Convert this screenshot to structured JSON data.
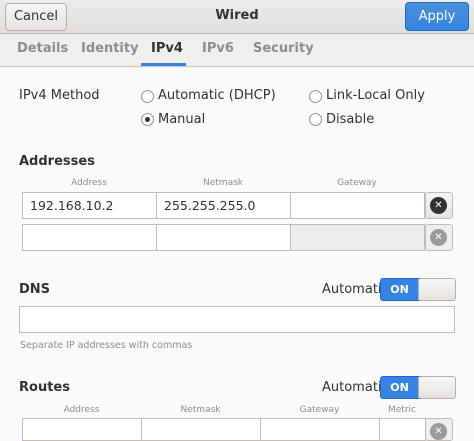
{
  "header": {
    "cancel_label": "Cancel",
    "title": "Wired",
    "apply_label": "Apply"
  },
  "tabs": [
    "Details",
    "Identity",
    "IPv4",
    "IPv6",
    "Security"
  ],
  "ipv4_method": {
    "label": "IPv4 Method",
    "options": [
      "Automatic (DHCP)",
      "Link-Local Only",
      "Manual",
      "Disable"
    ],
    "selected": "Manual"
  },
  "addresses": {
    "heading": "Addresses",
    "columns": [
      "Address",
      "Netmask",
      "Gateway"
    ],
    "rows": [
      {
        "address": "192.168.10.2",
        "netmask": "255.255.255.0",
        "gateway": ""
      },
      {
        "address": "",
        "netmask": "",
        "gateway": ""
      }
    ]
  },
  "dns": {
    "heading": "DNS",
    "automatic_label": "Automatic",
    "switch_label": "ON",
    "value": "",
    "hint": "Separate IP addresses with commas"
  },
  "routes": {
    "heading": "Routes",
    "automatic_label": "Automatic",
    "switch_label": "ON",
    "columns": [
      "Address",
      "Netmask",
      "Gateway",
      "Metric"
    ]
  },
  "colors": {
    "accent": "#3584e4",
    "text": "#2e3436",
    "muted": "#8b8e8f"
  }
}
